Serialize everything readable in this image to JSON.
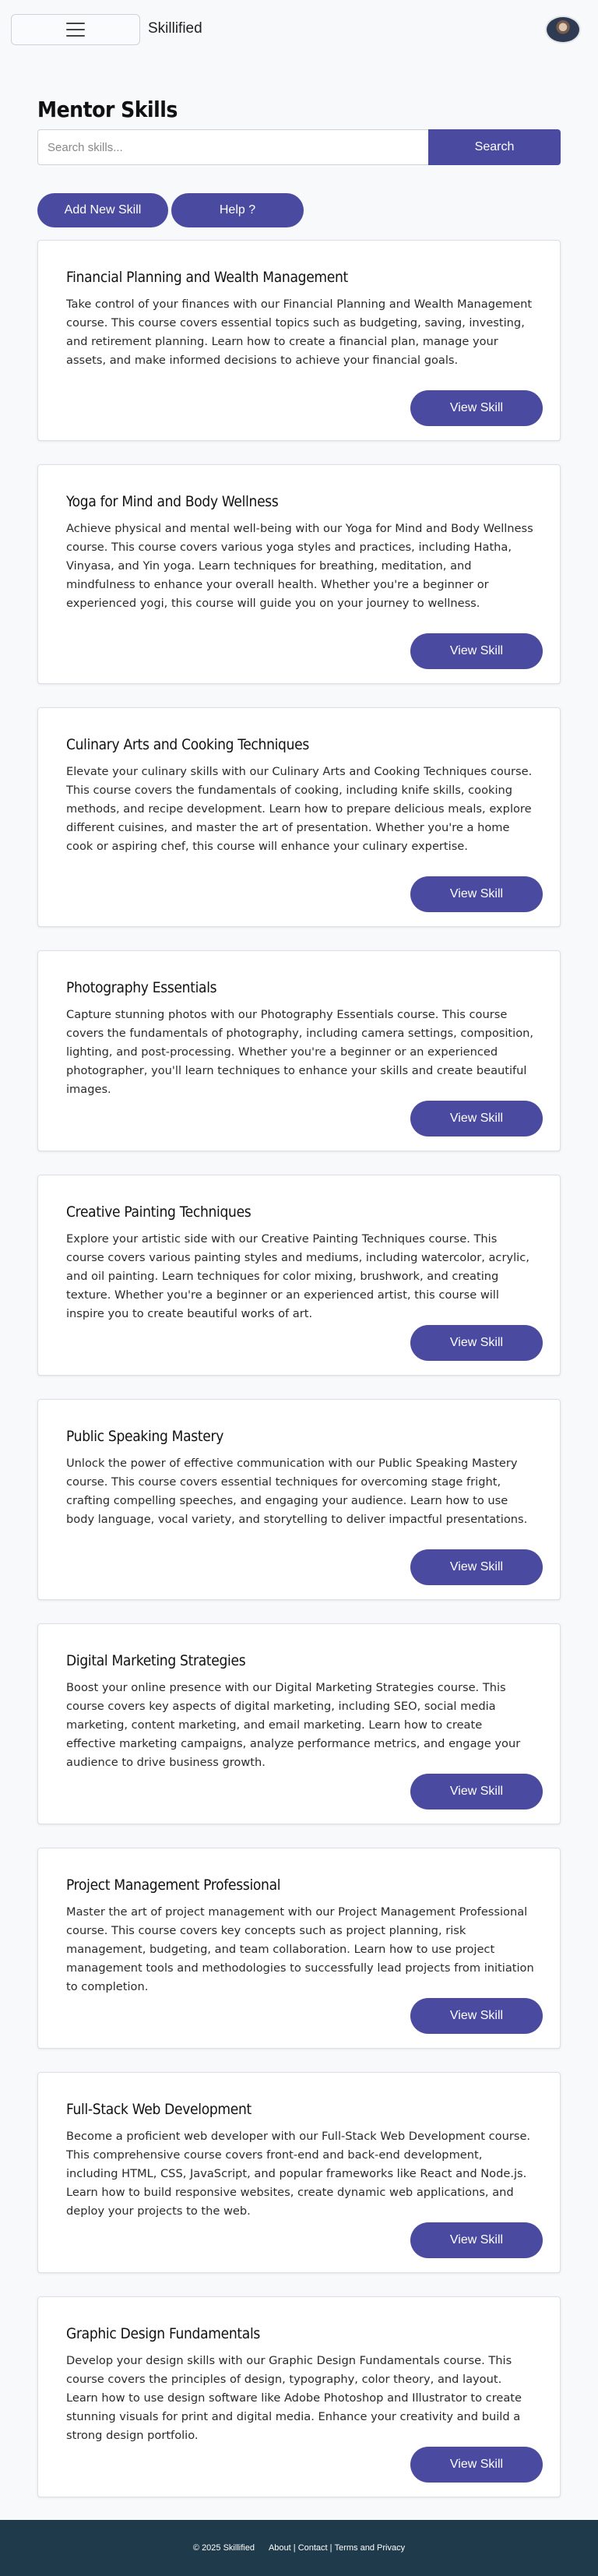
{
  "header": {
    "brand": "Skillified",
    "menu_icon": "hamburger-icon",
    "avatar_icon": "user-avatar"
  },
  "page": {
    "title": "Mentor Skills"
  },
  "search": {
    "placeholder": "Search skills...",
    "button_label": "Search"
  },
  "actions": {
    "add_label": "Add New Skill",
    "help_label": "Help ?"
  },
  "skills": [
    {
      "title": "Financial Planning and Wealth Management",
      "description": "Take control of your finances with our Financial Planning and Wealth Management course. This course covers essential topics such as budgeting, saving, investing, and retirement planning. Learn how to create a financial plan, manage your assets, and make informed decisions to achieve your financial goals.",
      "button_label": "View Skill"
    },
    {
      "title": "Yoga for Mind and Body Wellness",
      "description": "Achieve physical and mental well-being with our Yoga for Mind and Body Wellness course. This course covers various yoga styles and practices, including Hatha, Vinyasa, and Yin yoga. Learn techniques for breathing, meditation, and mindfulness to enhance your overall health. Whether you're a beginner or experienced yogi, this course will guide you on your journey to wellness.",
      "button_label": "View Skill"
    },
    {
      "title": "Culinary Arts and Cooking Techniques",
      "description": "Elevate your culinary skills with our Culinary Arts and Cooking Techniques course. This course covers the fundamentals of cooking, including knife skills, cooking methods, and recipe development. Learn how to prepare delicious meals, explore different cuisines, and master the art of presentation. Whether you're a home cook or aspiring chef, this course will enhance your culinary expertise.",
      "button_label": "View Skill"
    },
    {
      "title": "Photography Essentials",
      "description": "Capture stunning photos with our Photography Essentials course. This course covers the fundamentals of photography, including camera settings, composition, lighting, and post-processing. Whether you're a beginner or an experienced photographer, you'll learn techniques to enhance your skills and create beautiful images.",
      "button_label": "View Skill"
    },
    {
      "title": "Creative Painting Techniques",
      "description": "Explore your artistic side with our Creative Painting Techniques course. This course covers various painting styles and mediums, including watercolor, acrylic, and oil painting. Learn techniques for color mixing, brushwork, and creating texture. Whether you're a beginner or an experienced artist, this course will inspire you to create beautiful works of art.",
      "button_label": "View Skill"
    },
    {
      "title": "Public Speaking Mastery",
      "description": "Unlock the power of effective communication with our Public Speaking Mastery course. This course covers essential techniques for overcoming stage fright, crafting compelling speeches, and engaging your audience. Learn how to use body language, vocal variety, and storytelling to deliver impactful presentations.",
      "button_label": "View Skill"
    },
    {
      "title": "Digital Marketing Strategies",
      "description": "Boost your online presence with our Digital Marketing Strategies course. This course covers key aspects of digital marketing, including SEO, social media marketing, content marketing, and email marketing. Learn how to create effective marketing campaigns, analyze performance metrics, and engage your audience to drive business growth.",
      "button_label": "View Skill"
    },
    {
      "title": "Project Management Professional",
      "description": "Master the art of project management with our Project Management Professional course. This course covers key concepts such as project planning, risk management, budgeting, and team collaboration. Learn how to use project management tools and methodologies to successfully lead projects from initiation to completion.",
      "button_label": "View Skill"
    },
    {
      "title": "Full-Stack Web Development",
      "description": "Become a proficient web developer with our Full-Stack Web Development course. This comprehensive course covers front-end and back-end development, including HTML, CSS, JavaScript, and popular frameworks like React and Node.js. Learn how to build responsive websites, create dynamic web applications, and deploy your projects to the web.",
      "button_label": "View Skill"
    },
    {
      "title": "Graphic Design Fundamentals",
      "description": "Develop your design skills with our Graphic Design Fundamentals course. This course covers the principles of design, typography, color theory, and layout. Learn how to use design software like Adobe Photoshop and Illustrator to create stunning visuals for print and digital media. Enhance your creativity and build a strong design portfolio.",
      "button_label": "View Skill"
    }
  ],
  "footer": {
    "copyright": "© 2025 Skillified",
    "about": "About",
    "contact": "Contact",
    "terms": "Terms and Privacy",
    "sep": "|"
  },
  "colors": {
    "accent": "#4a4aa0",
    "footer_bg": "#1f3a4b",
    "page_bg": "#f8f9fb"
  }
}
